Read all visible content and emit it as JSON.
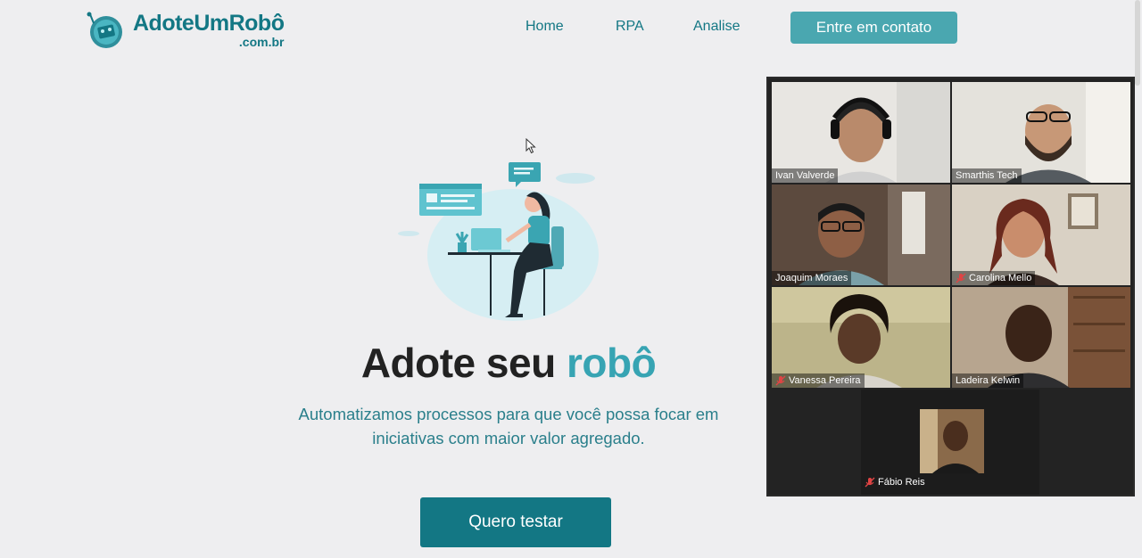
{
  "header": {
    "logo_main": "AdoteUmRobô",
    "logo_sub": ".com.br",
    "nav": [
      "Home",
      "RPA",
      "Analise"
    ],
    "contact_button": "Entre em contato"
  },
  "hero": {
    "title_part1": "Adote seu",
    "title_part2": "robô",
    "subtitle": "Automatizamos processos para que você possa focar em iniciativas com maior valor agregado.",
    "cta": "Quero testar"
  },
  "video_call": {
    "participants": [
      {
        "name": "Ivan Valverde",
        "muted": false,
        "active": false
      },
      {
        "name": "Smarthis Tech",
        "muted": false,
        "active": false
      },
      {
        "name": "Joaquim Moraes",
        "muted": false,
        "active": true
      },
      {
        "name": "Carolina Mello",
        "muted": true,
        "active": false
      },
      {
        "name": "Vanessa Pereira",
        "muted": true,
        "active": false
      },
      {
        "name": "Ladeira Kelwin",
        "muted": false,
        "active": false
      },
      {
        "name": "Fábio Reis",
        "muted": true,
        "active": false
      }
    ]
  },
  "colors": {
    "brand": "#137784",
    "accent": "#37a4b3",
    "button_light": "#4aa7b0",
    "background": "#eeeef0"
  }
}
